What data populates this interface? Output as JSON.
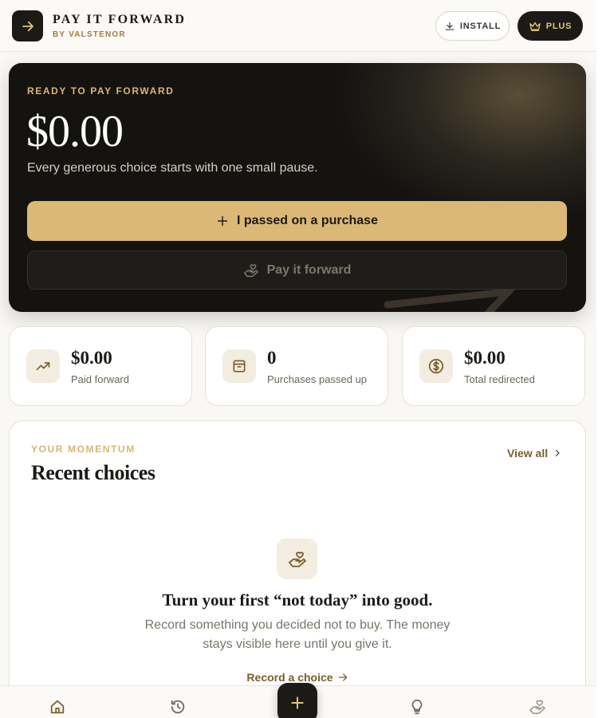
{
  "header": {
    "title": "PAY IT FORWARD",
    "subtitle": "BY VALSTENOR",
    "install_label": "INSTALL",
    "plus_label": "PLUS"
  },
  "hero": {
    "eyebrow": "READY TO PAY FORWARD",
    "amount": "$0.00",
    "tagline": "Every generous choice starts with one small pause.",
    "primary_button": "I passed on a purchase",
    "secondary_button": "Pay it forward"
  },
  "stats": [
    {
      "value": "$0.00",
      "label": "Paid forward",
      "icon": "trending-up-icon"
    },
    {
      "value": "0",
      "label": "Purchases passed up",
      "icon": "archive-box-icon"
    },
    {
      "value": "$0.00",
      "label": "Total redirected",
      "icon": "dollar-circle-icon"
    }
  ],
  "recent": {
    "eyebrow": "YOUR MOMENTUM",
    "title": "Recent choices",
    "view_all": "View all",
    "empty_title": "Turn your first “not today” into good.",
    "empty_body": "Record something you decided not to buy. The money stays visible here until you give it.",
    "record_link": "Record a choice"
  },
  "nav": {
    "items": [
      "home-icon",
      "history-icon",
      "add-icon",
      "lightbulb-icon",
      "hand-heart-icon"
    ]
  },
  "colors": {
    "accent_gold": "#dcb877",
    "dark": "#1c1a16",
    "link_brown": "#7a5e2c"
  }
}
